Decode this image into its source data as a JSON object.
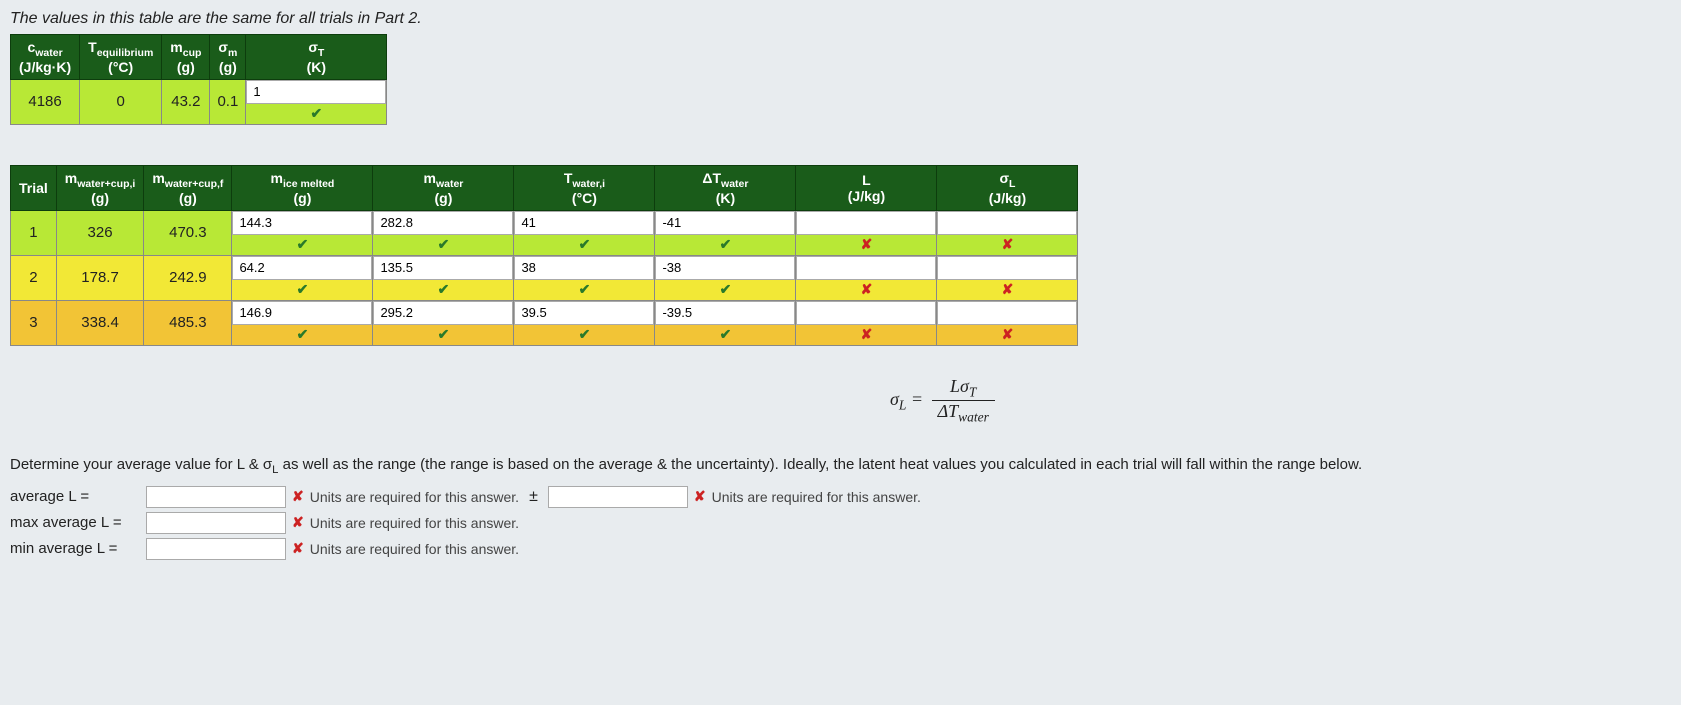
{
  "intro": "The values in this table are the same for all trials in Part 2.",
  "table1": {
    "headers": {
      "c_water": "c<sub>water</sub><br>(J/kg·K)",
      "t_eq": "T<sub>equilibrium</sub><br>(°C)",
      "m_cup": "m<sub>cup</sub><br>(g)",
      "sigma_m": "σ<sub>m</sub><br>(g)",
      "sigma_t": "σ<sub>T</sub><br>(K)"
    },
    "row": {
      "c_water": "4186",
      "t_eq": "0",
      "m_cup": "43.2",
      "sigma_m": "0.1",
      "sigma_t_input": "1"
    }
  },
  "table2": {
    "headers": {
      "trial": "Trial",
      "m_wci": "m<sub>water+cup,i</sub><br>(g)",
      "m_wcf": "m<sub>water+cup,f</sub><br>(g)",
      "m_ice": "m<sub>ice melted</sub><br>(g)",
      "m_water": "m<sub>water</sub><br>(g)",
      "t_wi": "T<sub>water,i</sub><br>(°C)",
      "dt_w": "ΔT<sub>water</sub><br>(K)",
      "L": "L<br>(J/kg)",
      "sigma_L": "σ<sub>L</sub><br>(J/kg)"
    },
    "rows": [
      {
        "trial": "1",
        "m_wci": "326",
        "m_wcf": "470.3",
        "m_ice": "144.3",
        "m_water": "282.8",
        "t_wi": "41",
        "dt_w": "-41",
        "L": "",
        "sigma_L": "",
        "bg": "lime",
        "marks": [
          "check",
          "check",
          "check",
          "check",
          "cross",
          "cross"
        ]
      },
      {
        "trial": "2",
        "m_wci": "178.7",
        "m_wcf": "242.9",
        "m_ice": "64.2",
        "m_water": "135.5",
        "t_wi": "38",
        "dt_w": "-38",
        "L": "",
        "sigma_L": "",
        "bg": "yellow",
        "marks": [
          "check",
          "check",
          "check",
          "check",
          "cross",
          "cross"
        ]
      },
      {
        "trial": "3",
        "m_wci": "338.4",
        "m_wcf": "485.3",
        "m_ice": "146.9",
        "m_water": "295.2",
        "t_wi": "39.5",
        "dt_w": "-39.5",
        "L": "",
        "sigma_L": "",
        "bg": "gold",
        "marks": [
          "check",
          "check",
          "check",
          "check",
          "cross",
          "cross"
        ]
      }
    ]
  },
  "formula": {
    "lhs": "σ<sub>L</sub> =",
    "num": "Lσ<sub>T</sub>",
    "den": "ΔT<sub>water</sub>"
  },
  "instruct": "Determine your average value for L & σ<sub>L</sub> as well as the range (the range is based on the average & the uncertainty). Ideally, the latent heat values you calculated in each trial will fall within the range below.",
  "answers": {
    "avg_label": "average L =",
    "max_label": "max average L =",
    "min_label": "min average L =",
    "units_msg": "Units are required for this answer.",
    "pm": "±"
  }
}
